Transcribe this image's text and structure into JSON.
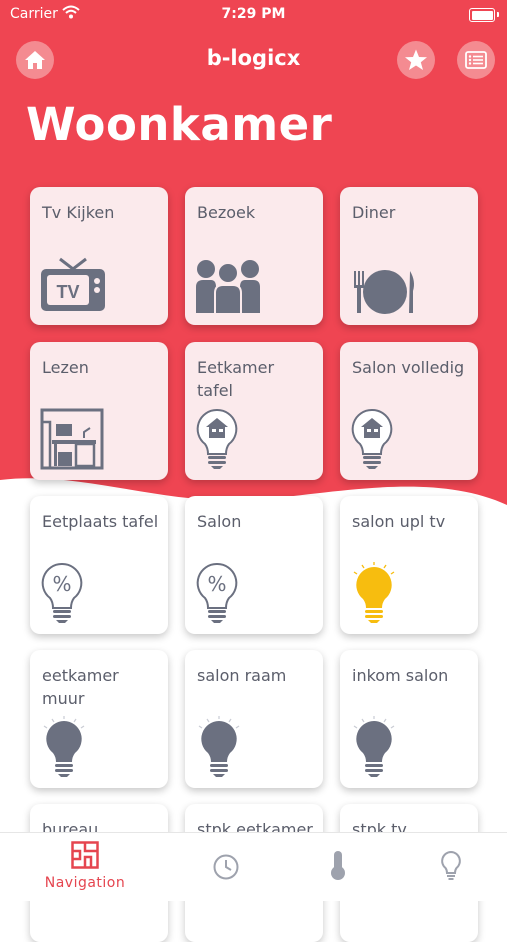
{
  "colors": {
    "accent": "#ef4552",
    "tile_pink": "#fbeaec",
    "icon_gray": "#6b7080",
    "bulb_on": "#f7bd0f"
  },
  "status_bar": {
    "carrier": "Carrier",
    "time": "7:29 PM"
  },
  "header": {
    "app_title": "b-logicx",
    "page_title": "Woonkamer"
  },
  "tiles": [
    {
      "label": "Tv Kijken",
      "icon": "tv-icon"
    },
    {
      "label": "Bezoek",
      "icon": "people-icon"
    },
    {
      "label": "Diner",
      "icon": "plate-icon"
    },
    {
      "label": "Lezen",
      "icon": "desk-icon"
    },
    {
      "label": "Eetkamer tafel",
      "icon": "house-bulb-icon"
    },
    {
      "label": "Salon volledig",
      "icon": "house-bulb-icon"
    },
    {
      "label": "Eetplaats tafel",
      "icon": "dimmer-bulb-icon"
    },
    {
      "label": "Salon",
      "icon": "dimmer-bulb-icon"
    },
    {
      "label": "salon upl tv",
      "icon": "bulb-on-icon"
    },
    {
      "label": "eetkamer muur",
      "icon": "bulb-off-icon"
    },
    {
      "label": "salon raam",
      "icon": "bulb-off-icon"
    },
    {
      "label": "inkom salon",
      "icon": "bulb-off-icon"
    },
    {
      "label": "bureau",
      "icon": ""
    },
    {
      "label": "stpk eetkamer",
      "icon": ""
    },
    {
      "label": "stpk tv",
      "icon": ""
    }
  ],
  "tabbar": {
    "navigation_label": "Navigation",
    "tabs": [
      "navigation-icon",
      "clock-icon",
      "thermometer-icon",
      "bulb-icon"
    ]
  }
}
